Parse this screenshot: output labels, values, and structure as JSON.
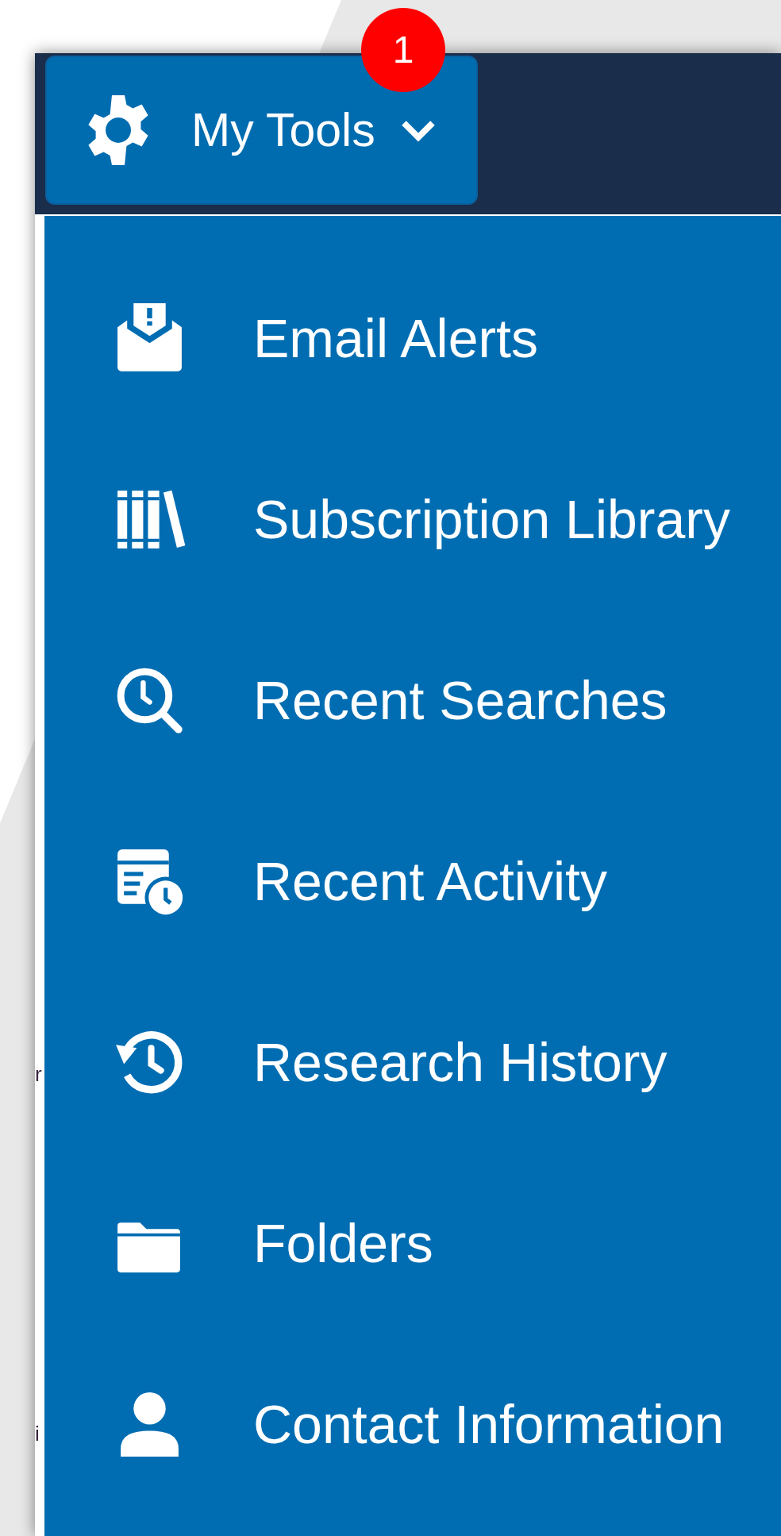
{
  "menu_button": {
    "label": "My Tools",
    "expanded": true,
    "badge": "1"
  },
  "menu": {
    "items": [
      {
        "label": "Email Alerts"
      },
      {
        "label": "Subscription Library"
      },
      {
        "label": "Recent Searches"
      },
      {
        "label": "Recent Activity"
      },
      {
        "label": "Research History"
      },
      {
        "label": "Folders"
      },
      {
        "label": "Contact Information"
      }
    ]
  },
  "background_text": [
    "r",
    "i"
  ]
}
